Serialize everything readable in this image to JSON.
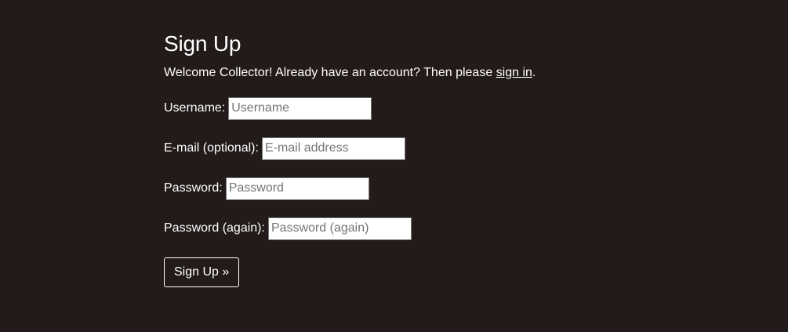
{
  "page": {
    "title": "Sign Up",
    "intro_before_link": "Welcome Collector! Already have an account? Then please ",
    "intro_link": "sign in",
    "intro_after_link": "."
  },
  "form": {
    "username": {
      "label": "Username:",
      "placeholder": "Username",
      "value": ""
    },
    "email": {
      "label": "E-mail (optional):",
      "placeholder": "E-mail address",
      "value": ""
    },
    "password": {
      "label": "Password:",
      "placeholder": "Password",
      "value": ""
    },
    "password2": {
      "label": "Password (again):",
      "placeholder": "Password (again)",
      "value": ""
    },
    "submit_label": "Sign Up »"
  },
  "colors": {
    "background": "#231a1a",
    "text": "#ffffff"
  }
}
